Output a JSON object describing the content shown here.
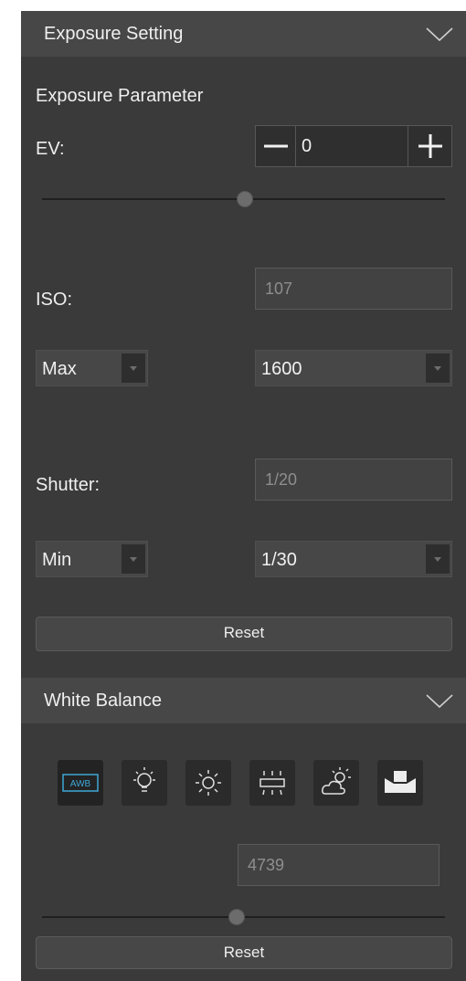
{
  "exposure": {
    "header_title": "Exposure Setting",
    "section_label": "Exposure Parameter",
    "ev_label": "EV:",
    "ev_value": "0",
    "ev_slider_level": 0.5,
    "iso_label": "ISO:",
    "iso_value": "107",
    "iso_mode": "Max",
    "iso_limit": "1600",
    "shutter_label": "Shutter:",
    "shutter_value": "1/20",
    "shutter_mode": "Min",
    "shutter_limit": "1/30",
    "reset_label": "Reset"
  },
  "white_balance": {
    "header_title": "White Balance",
    "presets": [
      {
        "name": "awb",
        "label": "AWB",
        "selected": true
      },
      {
        "name": "incandescent",
        "selected": false
      },
      {
        "name": "daylight",
        "selected": false
      },
      {
        "name": "fluorescent",
        "selected": false
      },
      {
        "name": "cloudy",
        "selected": false
      },
      {
        "name": "custom",
        "selected": false
      }
    ],
    "temperature_value": "4739",
    "temperature_slider_level": 0.48,
    "reset_label": "Reset"
  },
  "colors": {
    "panel_bg": "#3a3a3a",
    "header_bg": "#474747",
    "awb_accent": "#3fa7d6"
  }
}
